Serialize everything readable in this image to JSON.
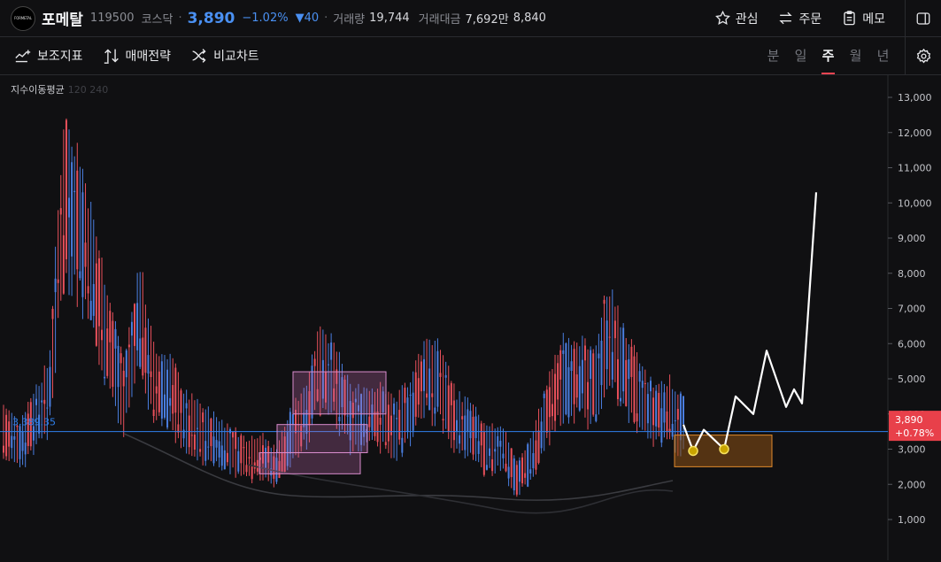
{
  "header": {
    "logo_text": "FORMETAL",
    "name": "포메탈",
    "code": "119500",
    "market": "코스닥",
    "price": "3,890",
    "change_pct": "−1.02%",
    "change_abs": "40",
    "volume_label": "거래량",
    "volume": "19,744",
    "amount_label": "거래대금",
    "amount": "7,692만",
    "extra_value": "8,840",
    "actions": {
      "watch": "관심",
      "order": "주문",
      "memo": "메모"
    }
  },
  "toolbar": {
    "indicators": "보조지표",
    "strategy": "매매전략",
    "compare": "비교차트",
    "periods": [
      "분",
      "일",
      "주",
      "월",
      "년"
    ],
    "active_period": "주"
  },
  "legend": {
    "title": "지수이동평균",
    "params": "120 240"
  },
  "chart_data": {
    "type": "candlestick",
    "y_ticks": [
      "13,000",
      "12,000",
      "11,000",
      "10,000",
      "9,000",
      "8,000",
      "7,000",
      "6,000",
      "5,000",
      "4,000",
      "3,000",
      "2,000",
      "1,000"
    ],
    "ylim": [
      0,
      13500
    ],
    "current_price_label": "3,890",
    "current_change_label": "+0.78%",
    "reference_line_label": "3,389.35",
    "reference_line_value": 3500,
    "colors": {
      "up": "#e8505b",
      "down": "#4a7ee0",
      "reference": "#2f80ed",
      "price_tag": "#e8404a"
    },
    "candles_anchor_highs": [
      4100,
      3600,
      4500,
      5200,
      12000,
      11000,
      9000,
      7000,
      5300,
      8000,
      5500,
      5500,
      4400,
      4100,
      3800,
      3500,
      3200,
      3300,
      2900,
      3900,
      4700,
      6400,
      5600,
      4500,
      4600,
      4600,
      4200,
      4900,
      6000,
      5600,
      4400,
      4100,
      3400,
      3600,
      2500,
      3300,
      4700,
      5900,
      6000,
      5400,
      7400,
      6200,
      5300,
      4600,
      4800,
      4300
    ],
    "boxes": [
      {
        "label": "box-1",
        "y_range": [
          4000,
          5200
        ]
      },
      {
        "label": "box-2",
        "y_range": [
          2900,
          3700
        ]
      },
      {
        "label": "box-3",
        "y_range": [
          2300,
          2900
        ]
      },
      {
        "label": "target-zone",
        "y_range": [
          2500,
          3400
        ]
      }
    ],
    "projection_path_values": [
      3700,
      2950,
      3550,
      3000,
      4500,
      4000,
      5800,
      4200,
      4700,
      4300,
      10300
    ]
  }
}
